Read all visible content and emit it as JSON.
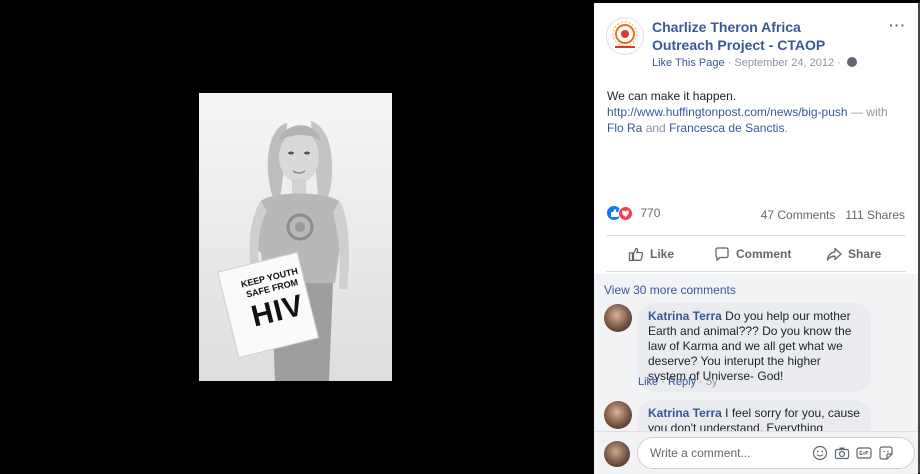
{
  "photo": {
    "sign_line1": "KEEP YOUTH",
    "sign_line2": "SAFE FROM",
    "sign_line3": "HIV"
  },
  "post": {
    "page_name": "Charlize Theron Africa Outreach Project - CTAOP",
    "like_page": "Like This Page",
    "separator": "·",
    "date": "September 24, 2012",
    "more": "···",
    "text_line1": "We can make it happen.",
    "link": "http://www.huffingtonpost.com/news/big-push",
    "with_text": "— with",
    "tag1": "Flo Ra",
    "and_text": "and",
    "tag2": "Francesca de Sanctis",
    "period": "."
  },
  "stats": {
    "reaction_count": "770",
    "comments": "47 Comments",
    "shares": "111 Shares"
  },
  "actions": {
    "like": "Like",
    "comment": "Comment",
    "share": "Share"
  },
  "comments": {
    "view_more": "View 30 more comments",
    "items": [
      {
        "author": "Katrina Terra",
        "text": "Do you help our mother Earth and animal??? Do you know the law of Karma and we all get what we deserve? You interupt the higher system of Universe- God!",
        "like": "Like",
        "reply": "Reply",
        "age": "5y"
      },
      {
        "author": "Katrina Terra",
        "text": "I feel sorry for you, cause you don't understand. Everything happen with a"
      }
    ]
  },
  "composer": {
    "placeholder": "Write a comment..."
  },
  "colors": {
    "link_blue": "#385898",
    "muted": "#90949c",
    "like_blue": "#1877f2",
    "love_red": "#f33e58"
  }
}
